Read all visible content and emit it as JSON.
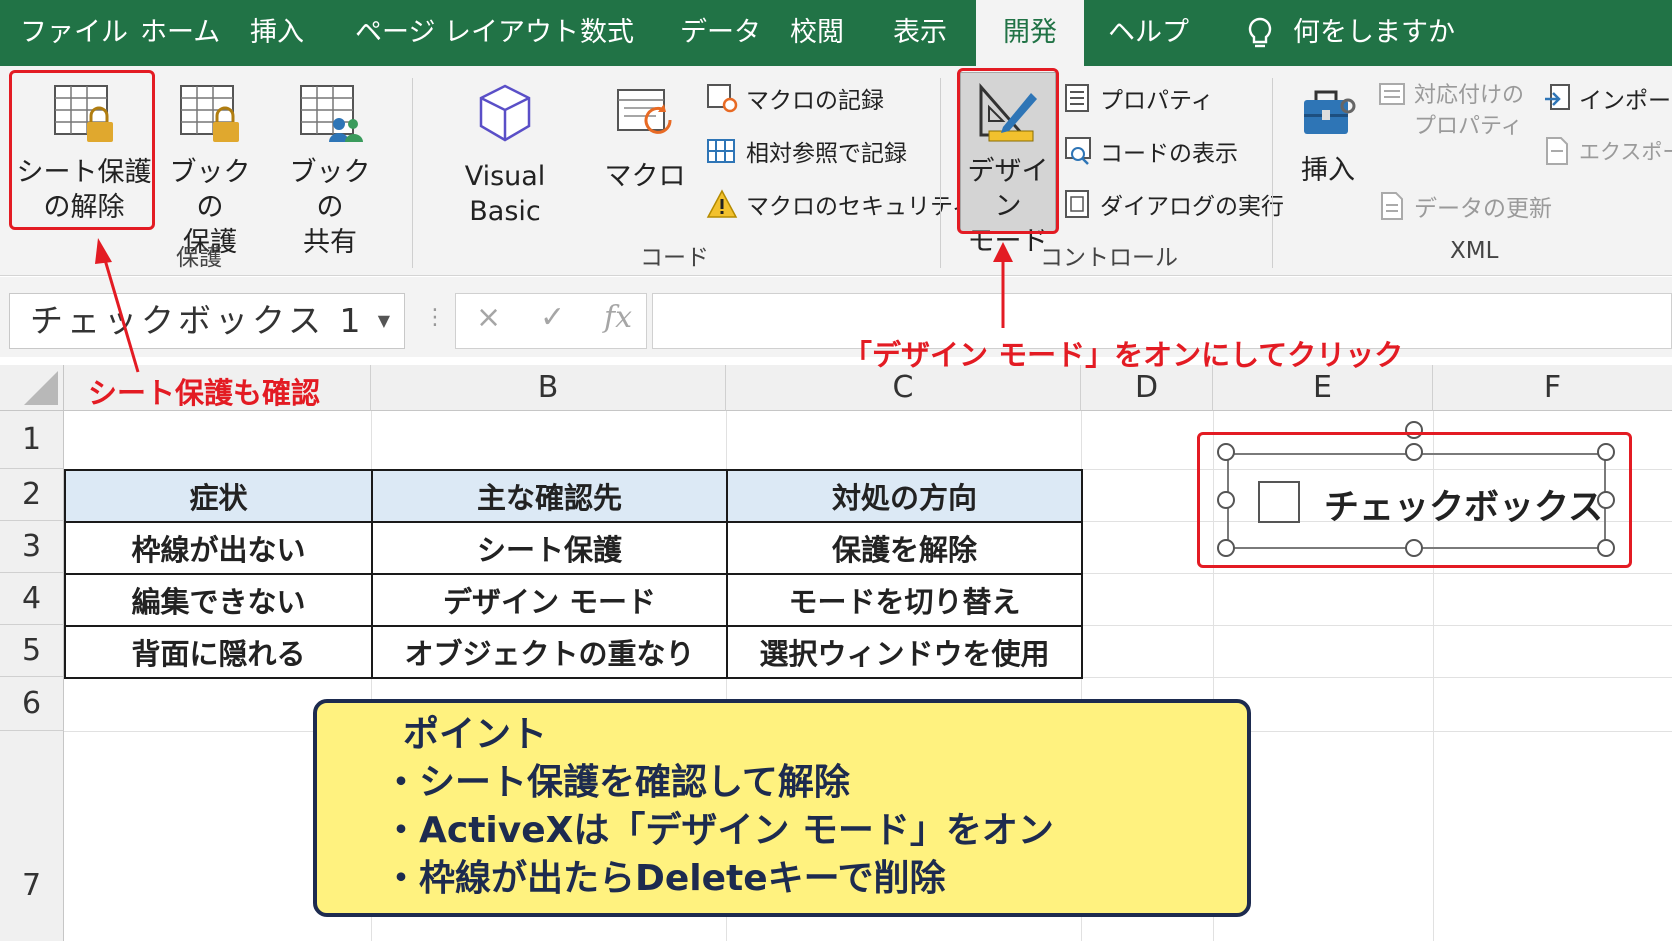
{
  "tabs": [
    "ファイル",
    "ホーム",
    "挿入",
    "ページ レイアウト",
    "数式",
    "データ",
    "校閲",
    "表示",
    "開発",
    "ヘルプ"
  ],
  "active_tab": "開発",
  "tell_me": {
    "text": "何をしますか",
    "icon": "lightbulb-icon"
  },
  "groups": {
    "protect": {
      "label": "保護",
      "buttons": [
        "シート保護\nの解除",
        "ブックの\n保護",
        "ブックの\n共有"
      ]
    },
    "code": {
      "label": "コード",
      "visual_basic": "Visual Basic",
      "macro": "マクロ",
      "items": [
        "マクロの記録",
        "相対参照で記録",
        "マクロのセキュリティ"
      ]
    },
    "controls": {
      "label": "コントロール",
      "design_mode": "デザイン\nモード",
      "items": [
        "プロパティ",
        "コードの表示",
        "ダイアログの実行"
      ]
    },
    "xml": {
      "label": "XML",
      "insert": "挿入",
      "map_properties": "対応付けの\nプロパティ",
      "refresh": "データの更新",
      "import": "インポート",
      "export": "エクスポート"
    }
  },
  "formula_bar": {
    "name_box": "チェックボックス 1",
    "fx": "fx",
    "cancel": "×",
    "enter": "✓"
  },
  "columns": [
    "B",
    "C",
    "D",
    "E",
    "F"
  ],
  "rows": [
    "1",
    "2",
    "3",
    "4",
    "5",
    "6",
    "7"
  ],
  "table": {
    "headers": [
      "症状",
      "主な確認先",
      "対処の方向"
    ],
    "rows": [
      [
        "枠線が出ない",
        "シート保護",
        "保護を解除"
      ],
      [
        "編集できない",
        "デザイン モード",
        "モードを切り替え"
      ],
      [
        "背面に隠れる",
        "オブジェクトの重なり",
        "選択ウィンドウを使用"
      ]
    ]
  },
  "checkbox": {
    "label": "チェックボックス"
  },
  "annotations": {
    "sheet_protect": "シート保護も確認",
    "design_mode": "「デザイン モード」をオンにしてクリック"
  },
  "point": {
    "title": "ポイント",
    "lines": [
      "・シート保護を確認して解除",
      "・ActiveXは「デザイン モード」をオン",
      "・枠線が出たらDeleteキーで削除"
    ]
  },
  "colors": {
    "excel_green": "#217346",
    "annotation_red": "#e31b23",
    "point_bg": "#fff27f",
    "point_border": "#1d2b4f",
    "header_fill": "#dce9f5"
  }
}
